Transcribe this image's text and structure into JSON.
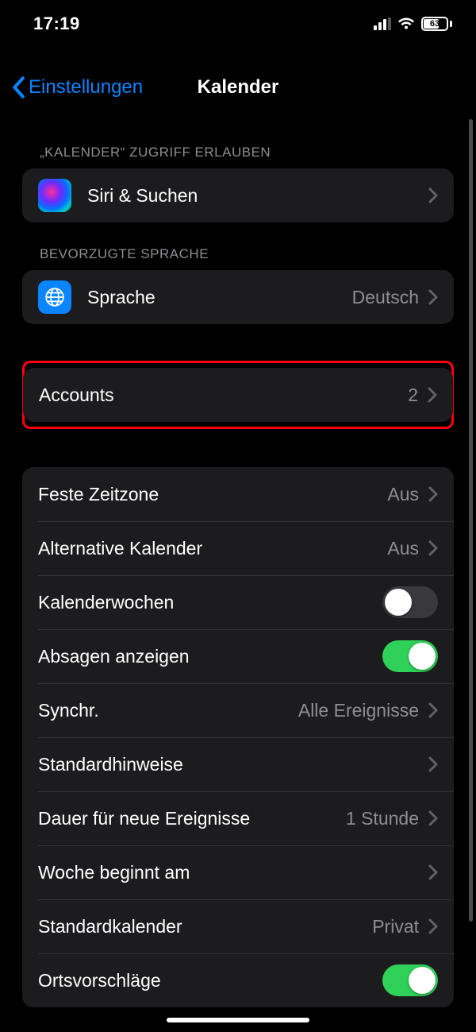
{
  "status": {
    "time": "17:19",
    "battery": "63"
  },
  "nav": {
    "back": "Einstellungen",
    "title": "Kalender"
  },
  "sections": {
    "access_header": "„KALENDER“ ZUGRIFF ERLAUBEN",
    "siri_label": "Siri & Suchen",
    "lang_header": "BEVORZUGTE SPRACHE",
    "lang_label": "Sprache",
    "lang_value": "Deutsch",
    "accounts_label": "Accounts",
    "accounts_value": "2"
  },
  "settings": {
    "timezone_label": "Feste Zeitzone",
    "timezone_value": "Aus",
    "altcal_label": "Alternative Kalender",
    "altcal_value": "Aus",
    "weeknum_label": "Kalenderwochen",
    "decline_label": "Absagen anzeigen",
    "sync_label": "Synchr.",
    "sync_value": "Alle Ereignisse",
    "alerts_label": "Standardhinweise",
    "duration_label": "Dauer für neue Ereignisse",
    "duration_value": "1 Stunde",
    "weekstart_label": "Woche beginnt am",
    "defaultcal_label": "Standardkalender",
    "defaultcal_value": "Privat",
    "locsuggest_label": "Ortsvorschläge"
  }
}
